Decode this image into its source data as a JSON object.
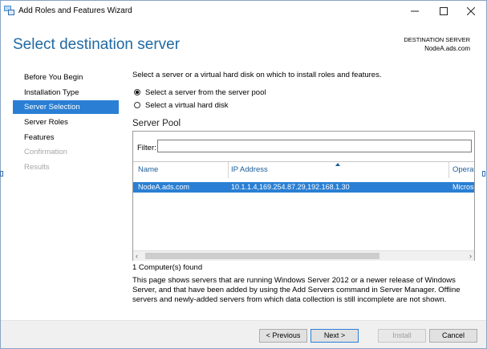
{
  "window": {
    "title": "Add Roles and Features Wizard",
    "minimize_glyph": "—",
    "maximize_glyph": "☐",
    "close_glyph": "✕"
  },
  "header": {
    "page_title": "Select destination server",
    "destination_label": "DESTINATION SERVER",
    "destination_value": "NodeA.ads.com"
  },
  "nav": {
    "items": [
      {
        "label": "Before You Begin",
        "state": "normal"
      },
      {
        "label": "Installation Type",
        "state": "normal"
      },
      {
        "label": "Server Selection",
        "state": "active"
      },
      {
        "label": "Server Roles",
        "state": "normal"
      },
      {
        "label": "Features",
        "state": "normal"
      },
      {
        "label": "Confirmation",
        "state": "disabled"
      },
      {
        "label": "Results",
        "state": "disabled"
      }
    ]
  },
  "content": {
    "instruction": "Select a server or a virtual hard disk on which to install roles and features.",
    "radio_pool": {
      "label": "Select a server from the server pool",
      "selected": true
    },
    "radio_vhd": {
      "label": "Select a virtual hard disk",
      "selected": false
    },
    "pool_title": "Server Pool",
    "filter_label": "Filter:",
    "filter_value": "",
    "columns": [
      "Name",
      "IP Address",
      "Operati"
    ],
    "rows": [
      {
        "name": "NodeA.ads.com",
        "ip": "10.1.1.4,169.254.87.29,192.168.1.30",
        "os": "Microsc"
      }
    ],
    "scroll_left_glyph": "‹",
    "scroll_right_glyph": "›",
    "found_text": "1 Computer(s) found",
    "description": "This page shows servers that are running Windows Server 2012 or a newer release of Windows Server, and that have been added by using the Add Servers command in Server Manager. Offline servers and newly-added servers from which data collection is still incomplete are not shown."
  },
  "footer": {
    "previous_label": "< Previous",
    "next_label": "Next >",
    "install_label": "Install",
    "cancel_label": "Cancel"
  },
  "colors": {
    "accent": "#2a7fd4",
    "title_blue": "#1f6aa5",
    "disabled_text": "#a6a6a6",
    "footer_bg": "#f0f0f0"
  },
  "icons": {
    "app": "server-manager-icon",
    "sort": "sort-ascending-icon"
  }
}
